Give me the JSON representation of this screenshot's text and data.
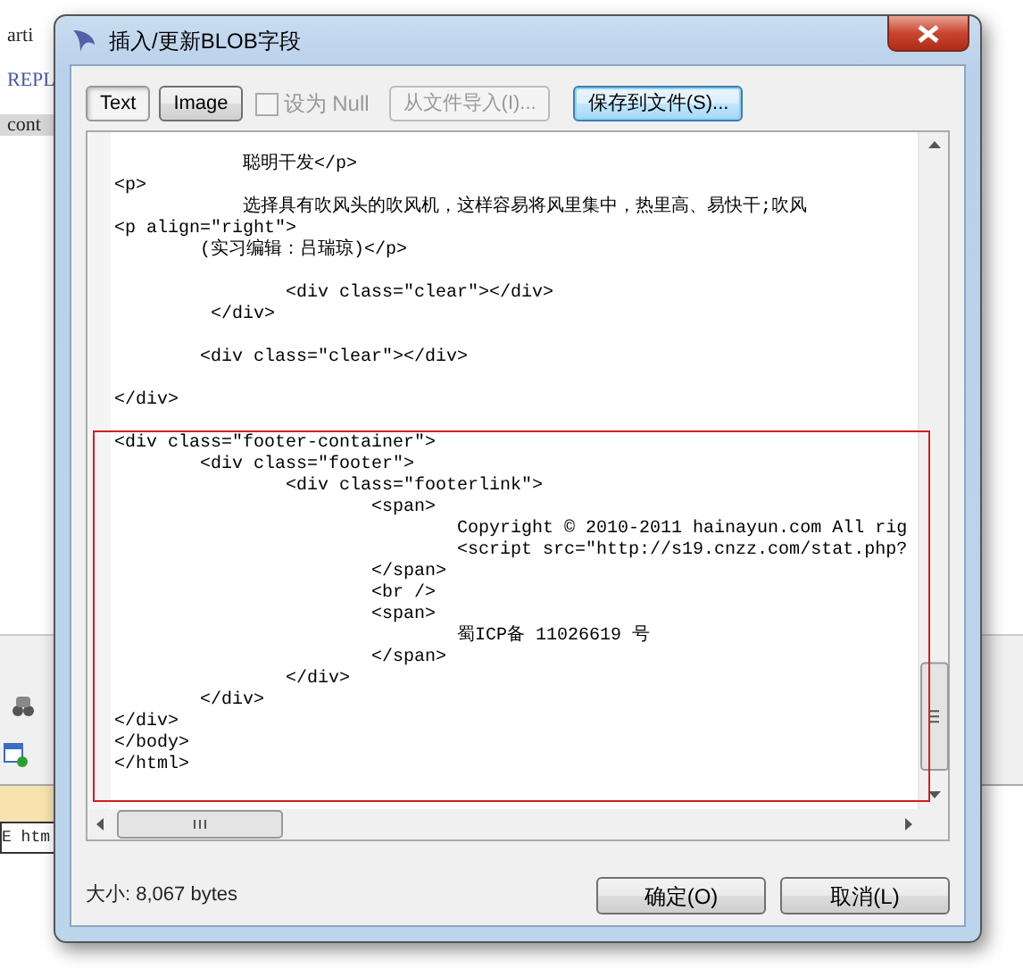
{
  "background": {
    "lines": [
      {
        "kind": "plain",
        "text": "arti"
      },
      {
        "kind": "keyword",
        "text": "REPL"
      },
      {
        "kind": "highlighted",
        "text": "cont"
      }
    ],
    "bottom_text": "E htm"
  },
  "window": {
    "title": "插入/更新BLOB字段"
  },
  "toolbar": {
    "tabs": [
      {
        "label": "Text",
        "selected": true
      },
      {
        "label": "Image",
        "selected": false
      }
    ],
    "null_checkbox": {
      "label": "设为 Null",
      "checked": false,
      "disabled": true
    },
    "buttons": [
      {
        "label": "从文件导入(I)...",
        "disabled": true,
        "focused": false
      },
      {
        "label": "保存到文件(S)...",
        "disabled": false,
        "focused": true
      }
    ]
  },
  "editor": {
    "lines": [
      {
        "kind": "code",
        "text": "            聪明干发</p>"
      },
      {
        "kind": "code",
        "text": "<p>"
      },
      {
        "kind": "code",
        "text": "            选择具有吹风头的吹风机，这样容易将风里集中，热里高、易快干;吹风"
      },
      {
        "kind": "code",
        "text": "<p align=\"right\">"
      },
      {
        "kind": "code",
        "text": "        (实习编辑：吕瑞琼)</p>"
      },
      {
        "kind": "blank"
      },
      {
        "kind": "code",
        "text": "                <div class=\"clear\"></div>"
      },
      {
        "kind": "code",
        "text": "         </div>"
      },
      {
        "kind": "blank"
      },
      {
        "kind": "code",
        "text": "        <div class=\"clear\"></div>"
      },
      {
        "kind": "blank"
      },
      {
        "kind": "code",
        "text": "</div>"
      },
      {
        "kind": "blank"
      },
      {
        "kind": "code",
        "text": "<div class=\"footer-container\">"
      },
      {
        "kind": "code",
        "text": "        <div class=\"footer\">"
      },
      {
        "kind": "code",
        "text": "                <div class=\"footerlink\">"
      },
      {
        "kind": "code",
        "text": "                        <span>"
      },
      {
        "kind": "code",
        "text": "                                Copyright © 2010-2011 hainayun.com All rig"
      },
      {
        "kind": "code",
        "text": "                                <script src=\"http://s19.cnzz.com/stat.php?"
      },
      {
        "kind": "code",
        "text": "                        </span>"
      },
      {
        "kind": "code",
        "text": "                        <br />"
      },
      {
        "kind": "code",
        "text": "                        <span>"
      },
      {
        "kind": "code",
        "text": "                                蜀ICP备 11026619 号"
      },
      {
        "kind": "code",
        "text": "                        </span>"
      },
      {
        "kind": "code",
        "text": "                </div>"
      },
      {
        "kind": "code",
        "text": "        </div>"
      },
      {
        "kind": "code",
        "text": "</div>"
      },
      {
        "kind": "code",
        "text": "</body>"
      },
      {
        "kind": "code",
        "text": "</html>"
      }
    ]
  },
  "status": {
    "size": "大小: 8,067 bytes"
  },
  "buttons": [
    "确定(O)",
    "取消(L)"
  ]
}
